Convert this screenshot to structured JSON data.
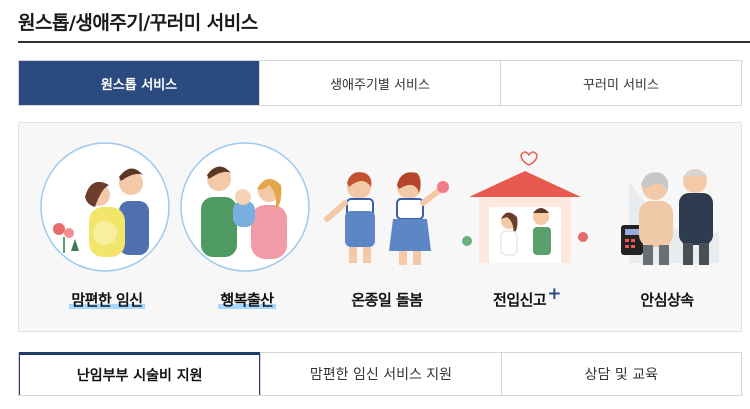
{
  "page_title": "원스톱/생애주기/꾸러미 서비스",
  "tabs": [
    {
      "label": "원스톱 서비스",
      "active": true
    },
    {
      "label": "생애주기별 서비스",
      "active": false
    },
    {
      "label": "꾸러미 서비스",
      "active": false
    }
  ],
  "services": [
    {
      "label": "맘편한 임신",
      "icon": "pregnant-couple-illustration"
    },
    {
      "label": "행복출산",
      "icon": "family-baby-illustration"
    },
    {
      "label": "온종일 돌봄",
      "icon": "children-illustration"
    },
    {
      "label": "전입신고",
      "plus": "+",
      "icon": "house-couple-illustration"
    },
    {
      "label": "안심상속",
      "icon": "elderly-couple-illustration"
    }
  ],
  "subtabs": [
    {
      "label": "난임부부 시술비 지원",
      "active": true
    },
    {
      "label": "맘편한 임신 서비스 지원",
      "active": false
    },
    {
      "label": "상담 및 교육",
      "active": false
    }
  ],
  "colors": {
    "primary": "#2a4a80",
    "highlight": "#a8d8ff",
    "panel_bg": "#f7f7f7"
  }
}
